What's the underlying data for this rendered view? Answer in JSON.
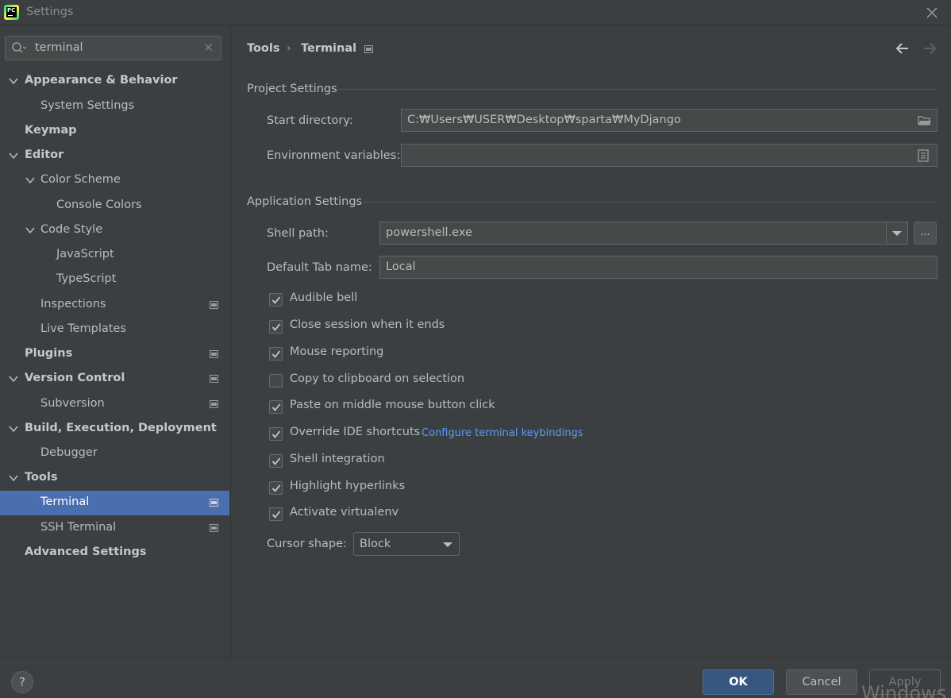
{
  "window": {
    "title": "Settings",
    "logo_text": "PC"
  },
  "search": {
    "value": "terminal"
  },
  "sidebar": {
    "items": [
      {
        "label": "Appearance & Behavior"
      },
      {
        "label": "System Settings"
      },
      {
        "label": "Keymap"
      },
      {
        "label": "Editor"
      },
      {
        "label": "Color Scheme"
      },
      {
        "label": "Console Colors"
      },
      {
        "label": "Code Style"
      },
      {
        "label": "JavaScript"
      },
      {
        "label": "TypeScript"
      },
      {
        "label": "Inspections"
      },
      {
        "label": "Live Templates"
      },
      {
        "label": "Plugins"
      },
      {
        "label": "Version Control"
      },
      {
        "label": "Subversion"
      },
      {
        "label": "Build, Execution, Deployment"
      },
      {
        "label": "Debugger"
      },
      {
        "label": "Tools"
      },
      {
        "label": "Terminal"
      },
      {
        "label": "SSH Terminal"
      },
      {
        "label": "Advanced Settings"
      }
    ]
  },
  "breadcrumb": {
    "parent": "Tools",
    "current": "Terminal"
  },
  "project_settings": {
    "title": "Project Settings",
    "start_directory_label": "Start directory:",
    "start_directory_value": "C:₩Users₩USER₩Desktop₩sparta₩MyDjango",
    "env_vars_label": "Environment variables:",
    "env_vars_value": ""
  },
  "app_settings": {
    "title": "Application Settings",
    "shell_path_label": "Shell path:",
    "shell_path_value": "powershell.exe",
    "browse_label": "...",
    "tab_name_label": "Default Tab name:",
    "tab_name_value": "Local",
    "checkboxes": [
      {
        "label": "Audible bell",
        "checked": true
      },
      {
        "label": "Close session when it ends",
        "checked": true
      },
      {
        "label": "Mouse reporting",
        "checked": true
      },
      {
        "label": "Copy to clipboard on selection",
        "checked": false
      },
      {
        "label": "Paste on middle mouse button click",
        "checked": true
      },
      {
        "label": "Override IDE shortcuts",
        "checked": true
      },
      {
        "label": "Shell integration",
        "checked": true
      },
      {
        "label": "Highlight hyperlinks",
        "checked": true
      },
      {
        "label": "Activate virtualenv",
        "checked": true
      }
    ],
    "keybindings_link": "Configure terminal keybindings",
    "cursor_shape_label": "Cursor shape:",
    "cursor_shape_value": "Block"
  },
  "footer": {
    "help_label": "?",
    "ok_label": "OK",
    "cancel_label": "Cancel",
    "apply_label": "Apply",
    "watermark": "Windows"
  },
  "colors": {
    "background": "#3c3f41",
    "selection": "#4b6eaf",
    "link": "#589df6",
    "ok_button": "#365880"
  }
}
